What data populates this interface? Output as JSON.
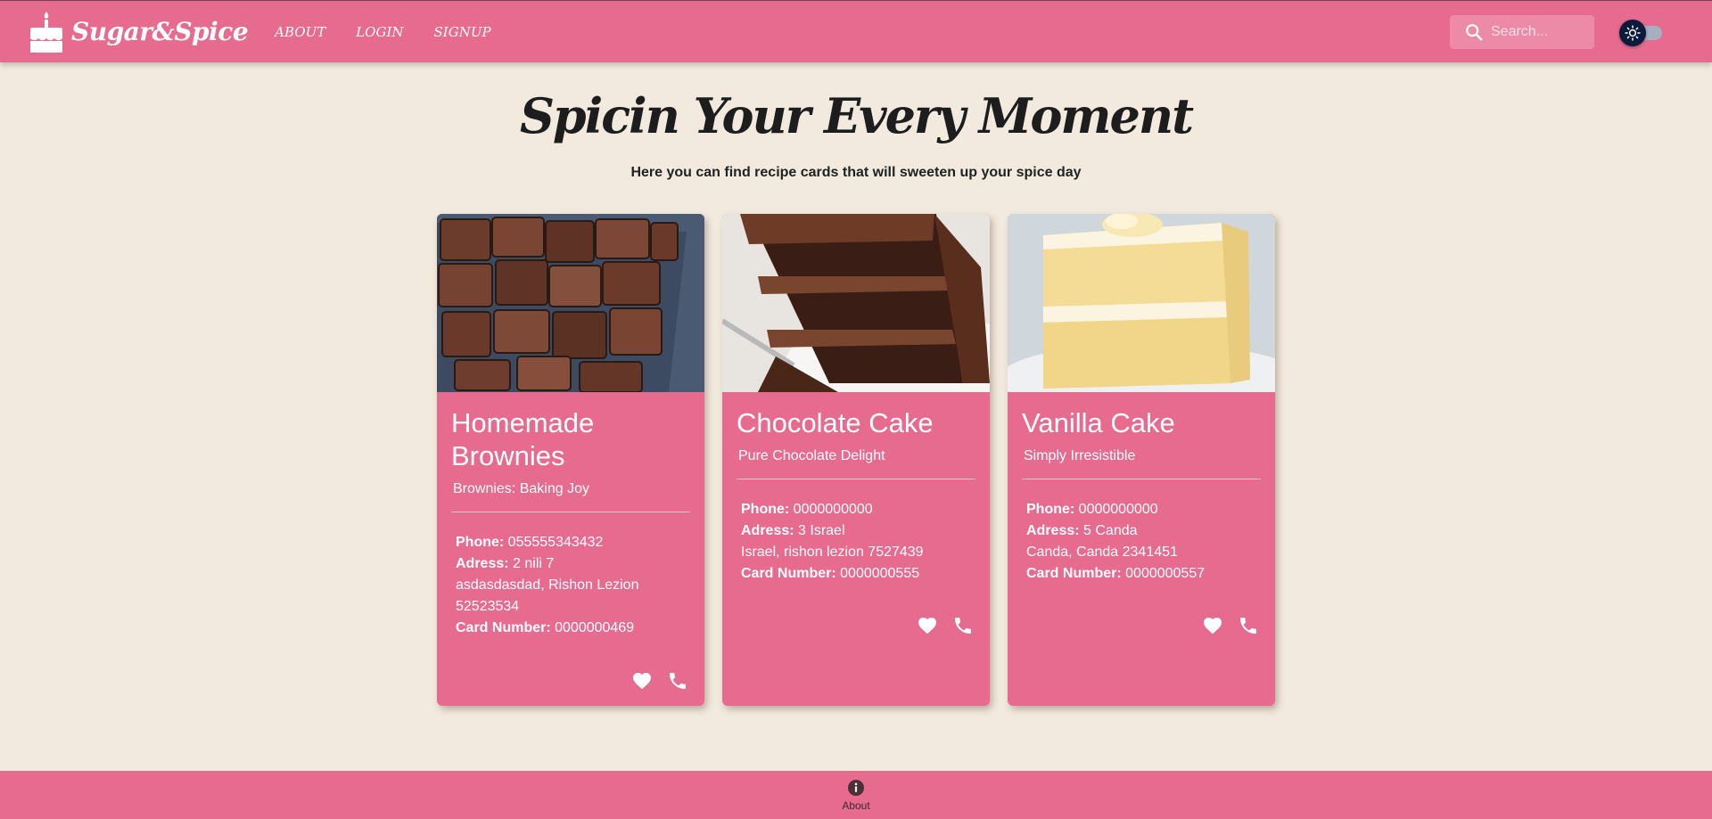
{
  "navbar": {
    "brand": "Sugar&Spice",
    "links": [
      "ABOUT",
      "LOGIN",
      "SIGNUP"
    ],
    "search_placeholder": "Search...",
    "theme_toggle": "light"
  },
  "hero": {
    "title": "Spicin Your Every Moment",
    "subtitle": "Here you can find recipe cards that will sweeten up your spice day"
  },
  "cards": [
    {
      "title": "Homemade Brownies",
      "subtitle": "Brownies: Baking Joy",
      "phone_label": "Phone:",
      "phone": "055555343432",
      "address_label": "Adress:",
      "address_line1": "2 nili 7",
      "address_line2": "asdasdasdad, Rishon Lezion",
      "address_line3": "52523534",
      "card_number_label": "Card Number:",
      "card_number": "0000000469",
      "image": "brownies-photo"
    },
    {
      "title": "Chocolate Cake",
      "subtitle": "Pure Chocolate Delight",
      "phone_label": "Phone:",
      "phone": "0000000000",
      "address_label": "Adress:",
      "address_line1": "3 Israel",
      "address_line2": "Israel, rishon lezion 7527439",
      "address_line3": "",
      "card_number_label": "Card Number:",
      "card_number": "0000000555",
      "image": "chocolate-cake-photo"
    },
    {
      "title": "Vanilla Cake",
      "subtitle": "Simply Irresistible",
      "phone_label": "Phone:",
      "phone": "0000000000",
      "address_label": "Adress:",
      "address_line1": "5 Canda",
      "address_line2": "Canda, Canda 2341451",
      "address_line3": "",
      "card_number_label": "Card Number:",
      "card_number": "0000000557",
      "image": "vanilla-cake-photo"
    }
  ],
  "footer": {
    "about_label": "About"
  },
  "colors": {
    "primary": "#e76a8f",
    "background": "#f2eadf",
    "toggle_thumb": "#0c1a3c"
  }
}
